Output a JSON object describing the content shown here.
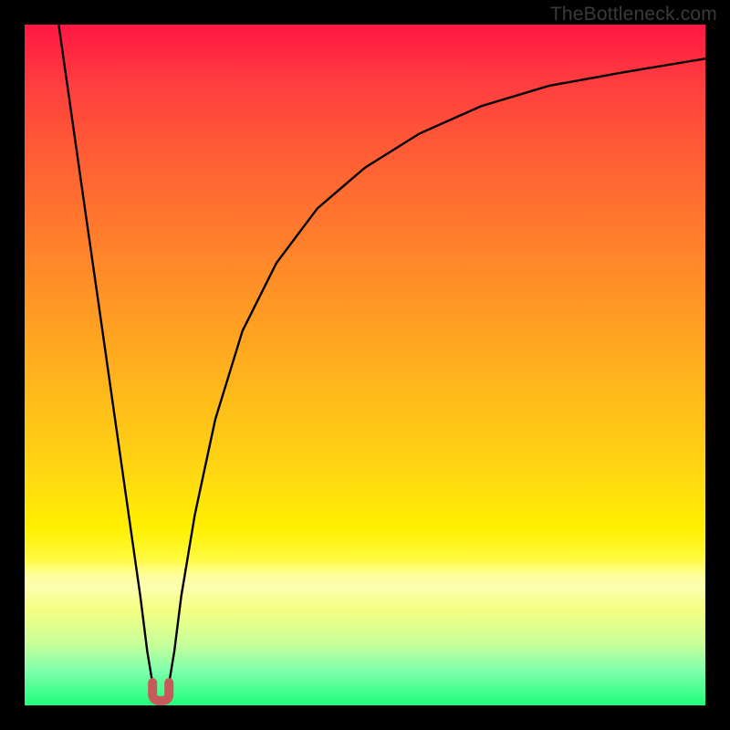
{
  "watermark": {
    "text": "TheBottleneck.com"
  },
  "chart_data": {
    "type": "line",
    "title": "",
    "xlabel": "",
    "ylabel": "",
    "xlim": [
      0,
      100
    ],
    "ylim": [
      0,
      100
    ],
    "grid": false,
    "legend": false,
    "background_gradient": {
      "top": "#ff1744",
      "middle": "#ffd400",
      "bottom": "#1eff7a"
    },
    "series": [
      {
        "name": "bottleneck-curve",
        "color": "#000000",
        "x": [
          5,
          7,
          9,
          11,
          13,
          15,
          17,
          18,
          19,
          20,
          21,
          22,
          23,
          25,
          28,
          32,
          37,
          43,
          50,
          58,
          67,
          77,
          88,
          100
        ],
        "y": [
          100,
          86,
          72,
          58,
          44,
          30,
          16,
          8,
          2,
          0,
          2,
          8,
          16,
          28,
          42,
          55,
          65,
          73,
          79,
          84,
          88,
          91,
          93,
          95
        ]
      }
    ],
    "marker": {
      "name": "sweet-spot-marker",
      "color": "#c75a5a",
      "x_center": 20,
      "y_center": 1.2,
      "shape": "U"
    },
    "annotations": []
  }
}
